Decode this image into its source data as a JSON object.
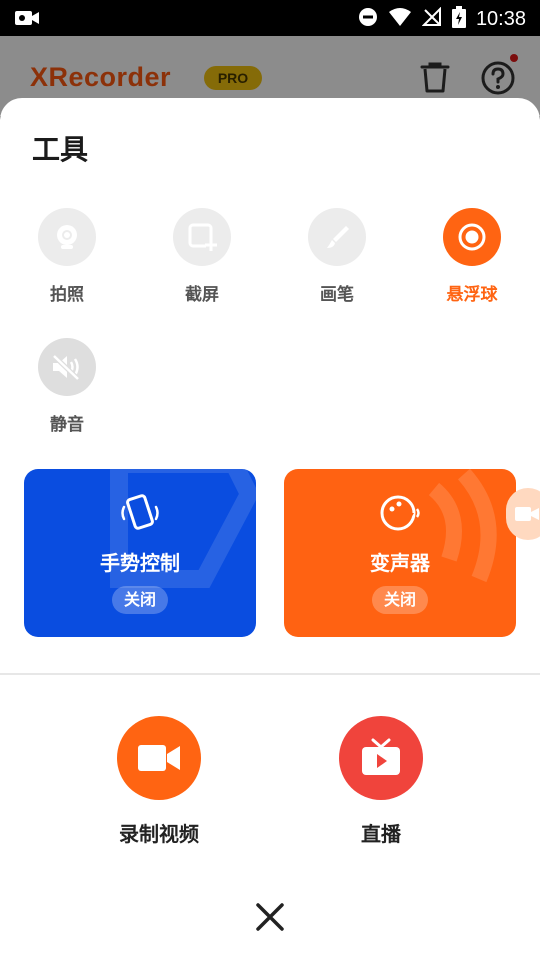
{
  "status_bar": {
    "time": "10:38"
  },
  "app_header": {
    "logo": "XRecorder",
    "pro_badge": "PRO"
  },
  "sheet": {
    "title": "工具",
    "tools": [
      {
        "label": "拍照",
        "icon": "camera-icon",
        "active": false
      },
      {
        "label": "截屏",
        "icon": "screenshot-icon",
        "active": false
      },
      {
        "label": "画笔",
        "icon": "brush-icon",
        "active": false
      },
      {
        "label": "悬浮球",
        "icon": "floating-ball-icon",
        "active": true
      },
      {
        "label": "静音",
        "icon": "mute-icon",
        "active": false
      }
    ],
    "cards": [
      {
        "title": "手势控制",
        "status": "关闭",
        "icon": "shake-phone-icon"
      },
      {
        "title": "变声器",
        "status": "关闭",
        "icon": "voice-changer-icon"
      }
    ],
    "actions": [
      {
        "label": "录制视频",
        "icon": "video-camera-icon"
      },
      {
        "label": "直播",
        "icon": "live-tv-icon"
      }
    ]
  },
  "colors": {
    "brand_orange": "#ff6412",
    "blue_card": "#0a4de0",
    "live_red": "#f0443c",
    "pro_yellow": "#f3c30f"
  }
}
